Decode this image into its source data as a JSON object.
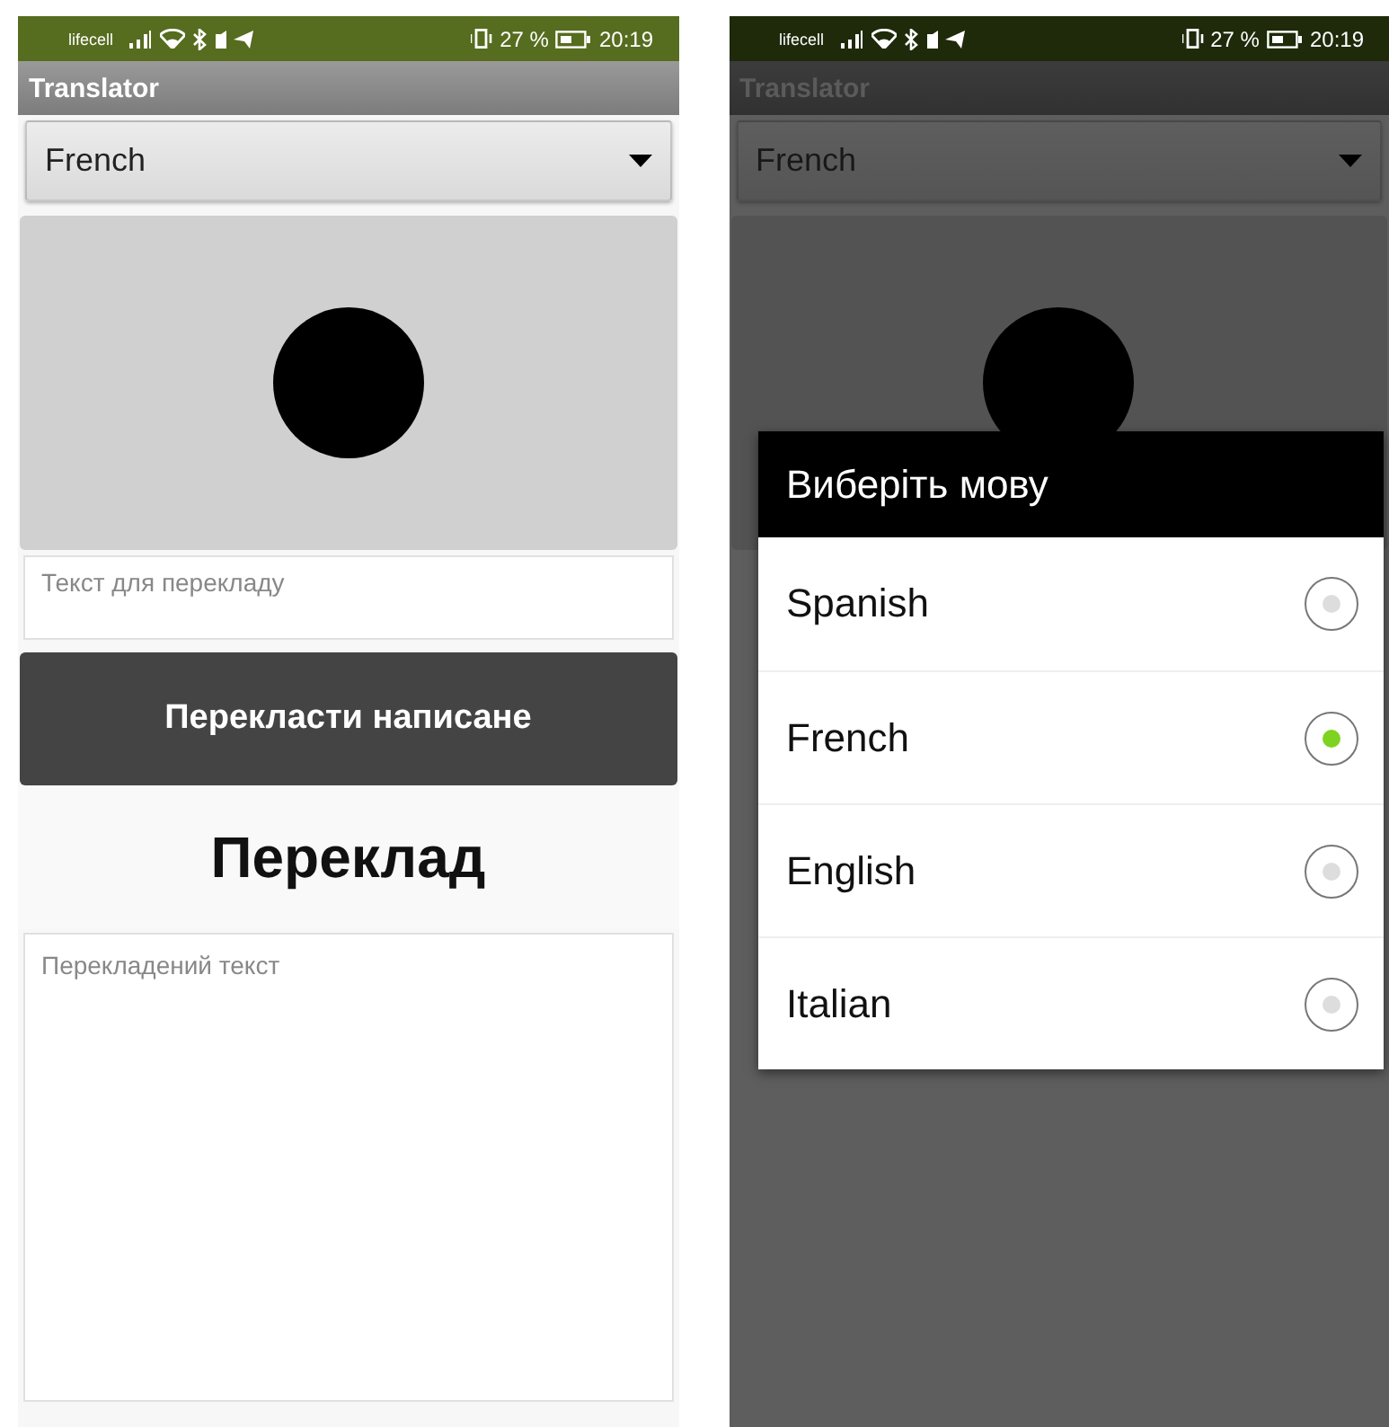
{
  "screens": [
    {
      "status_bar": {
        "carrier": "lifecell",
        "battery": "27 %",
        "time": "20:19"
      },
      "title": "Translator",
      "spinner": {
        "value": "French"
      },
      "input": {
        "placeholder": "Текст для перекладу"
      },
      "translate_button": "Перекласти написане",
      "heading": "Переклад",
      "output": {
        "placeholder": "Перекладений текст"
      }
    },
    {
      "status_bar": {
        "carrier": "lifecell",
        "battery": "27 %",
        "time": "20:19"
      },
      "title": "Translator",
      "spinner": {
        "value": "French"
      },
      "dialog": {
        "title": "Виберіть мову",
        "options": [
          {
            "label": "Spanish",
            "selected": false
          },
          {
            "label": "French",
            "selected": true
          },
          {
            "label": "English",
            "selected": false
          },
          {
            "label": "Italian",
            "selected": false
          }
        ]
      }
    }
  ]
}
